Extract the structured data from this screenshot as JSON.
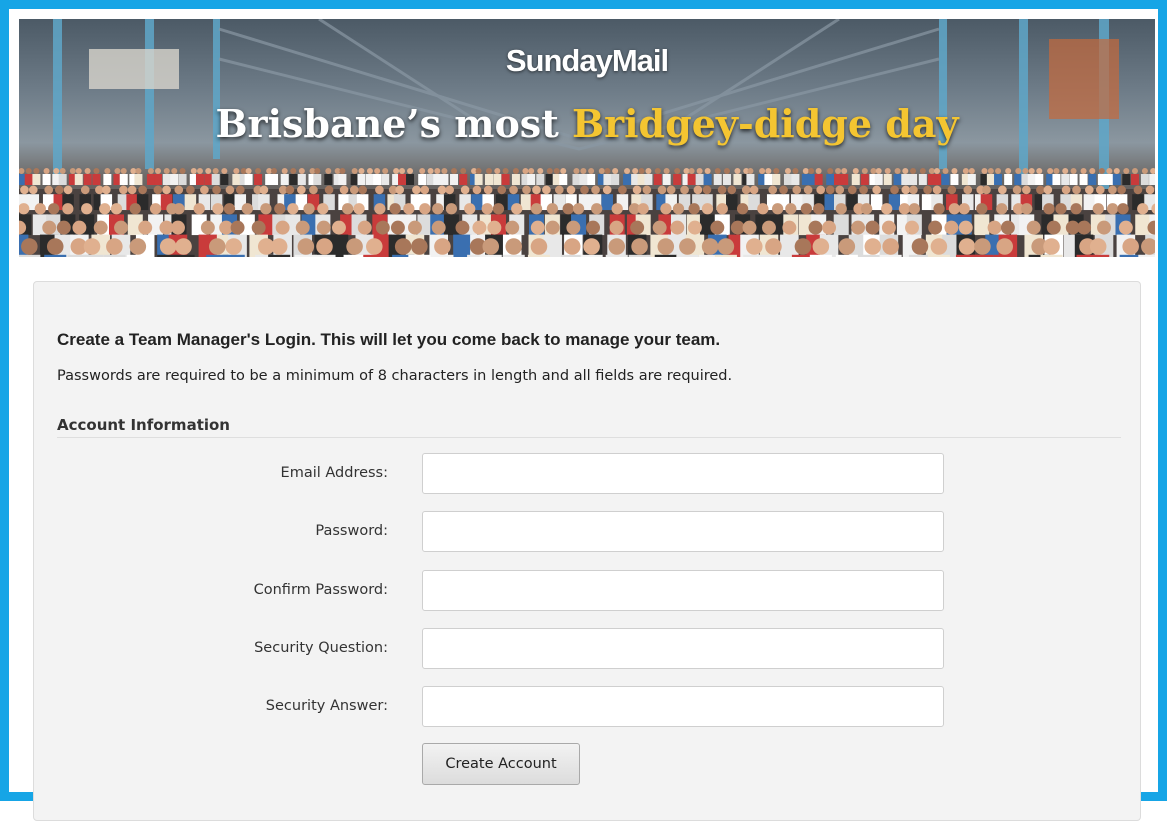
{
  "banner": {
    "masthead": "SundayMail",
    "headline_part1": "Brisbane’s most ",
    "headline_accent": "Bridgey-didge day",
    "accent_color": "#f4c531"
  },
  "form": {
    "intro_title": "Create a Team Manager's Login. This will let you come back to manage your team.",
    "intro_note": "Passwords are required to be a minimum of 8 characters in length and all fields are required.",
    "section_heading": "Account Information",
    "fields": [
      {
        "label": "Email Address:",
        "value": ""
      },
      {
        "label": "Password:",
        "value": ""
      },
      {
        "label": "Confirm Password:",
        "value": ""
      },
      {
        "label": "Security Question:",
        "value": ""
      },
      {
        "label": "Security Answer:",
        "value": ""
      }
    ],
    "submit_label": "Create Account"
  },
  "colors": {
    "frame_border": "#16a5e6",
    "panel_background": "#f3f3f3"
  }
}
